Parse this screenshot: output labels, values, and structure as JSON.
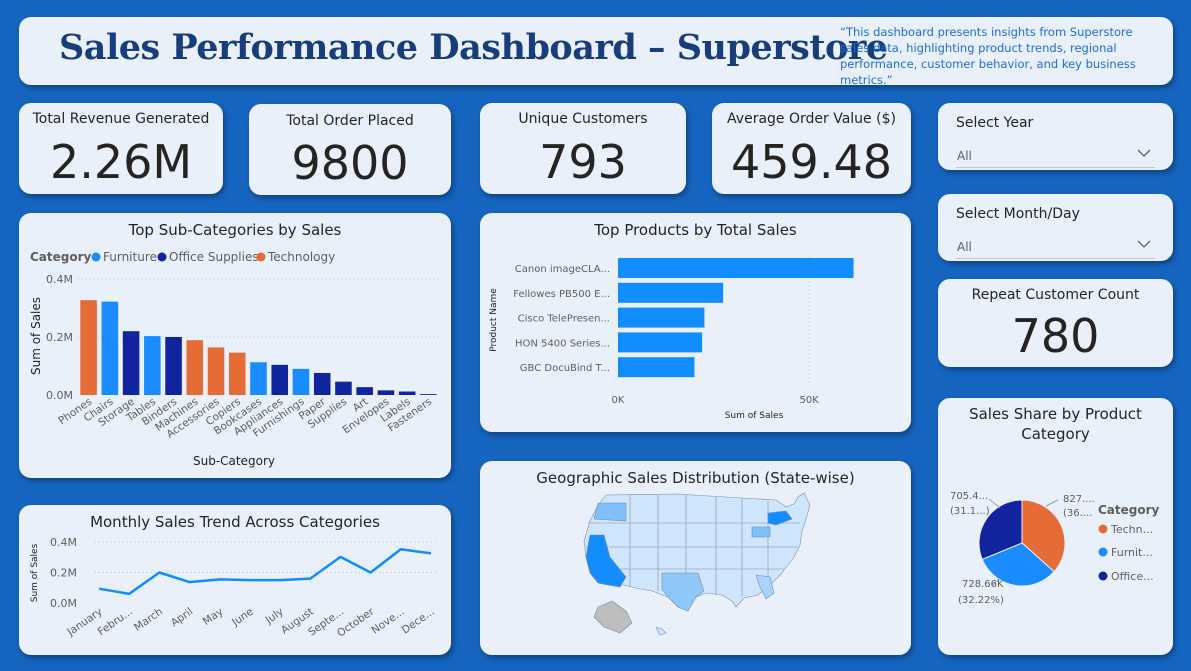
{
  "header": {
    "title": "Sales Performance Dashboard – Superstore",
    "description": "“This dashboard presents insights from Superstore sales data, highlighting product trends, regional performance, customer behavior, and key business metrics.”"
  },
  "kpis": {
    "revenue": {
      "label": "Total Revenue Generated",
      "value": "2.26M"
    },
    "orders": {
      "label": "Total Order Placed",
      "value": "9800"
    },
    "customers": {
      "label": "Unique Customers",
      "value": "793"
    },
    "aov": {
      "label": "Average Order Value ($)",
      "value": "459.48"
    },
    "repeat": {
      "label": "Repeat Customer Count",
      "value": "780"
    }
  },
  "slicers": {
    "year": {
      "label": "Select Year",
      "value": "All"
    },
    "month": {
      "label": "Select Month/Day",
      "value": "All"
    }
  },
  "colors": {
    "Furniture": "#1a8cff",
    "Office Supplies": "#12239e",
    "Technology": "#e66c37",
    "map_fill": "#cfe5fb",
    "map_high": "#118dff"
  },
  "map": {
    "title": "Geographic Sales Distribution (State-wise)"
  },
  "chart_data": [
    {
      "id": "subcat",
      "type": "bar",
      "title": "Top Sub-Categories by Sales",
      "xlabel": "Sub-Category",
      "ylabel": "Sum of Sales",
      "legend_title": "Category",
      "legend": [
        "Furniture",
        "Office Supplies",
        "Technology"
      ],
      "yticks": [
        "0.0M",
        "0.2M",
        "0.4M"
      ],
      "ylim": [
        0,
        400000
      ],
      "grid": true,
      "categories": [
        "Phones",
        "Chairs",
        "Storage",
        "Tables",
        "Binders",
        "Machines",
        "Accessories",
        "Copiers",
        "Bookcases",
        "Appliances",
        "Furnishings",
        "Paper",
        "Supplies",
        "Art",
        "Envelopes",
        "Labels",
        "Fasteners"
      ],
      "values": [
        327000,
        322000,
        220000,
        203000,
        200000,
        189000,
        164000,
        146000,
        113000,
        104000,
        90000,
        76000,
        46000,
        27000,
        16000,
        12000,
        3000
      ],
      "category_group": [
        "Technology",
        "Furniture",
        "Office Supplies",
        "Furniture",
        "Office Supplies",
        "Technology",
        "Technology",
        "Technology",
        "Furniture",
        "Office Supplies",
        "Furniture",
        "Office Supplies",
        "Office Supplies",
        "Office Supplies",
        "Office Supplies",
        "Office Supplies",
        "Office Supplies"
      ]
    },
    {
      "id": "products",
      "type": "bar",
      "orientation": "horizontal",
      "title": "Top Products by Total Sales",
      "xlabel": "Sum of Sales",
      "ylabel": "Product Name",
      "xticks": [
        "0K",
        "50K"
      ],
      "xlim": [
        0,
        68000
      ],
      "categories": [
        "Canon imageCLA...",
        "Fellowes PB500 E...",
        "Cisco TelePresen...",
        "HON 5400 Series...",
        "GBC DocuBind T..."
      ],
      "values": [
        61600,
        27500,
        22600,
        22000,
        20000
      ]
    },
    {
      "id": "monthly",
      "type": "line",
      "title": "Monthly Sales Trend Across Categories",
      "ylabel": "Sum of Sales",
      "yticks": [
        "0.0M",
        "0.2M",
        "0.4M"
      ],
      "ylim": [
        0,
        400000
      ],
      "x": [
        "January",
        "Febru...",
        "March",
        "April",
        "May",
        "June",
        "July",
        "August",
        "Septe...",
        "October",
        "Nove...",
        "Dece..."
      ],
      "values": [
        94000,
        60000,
        200000,
        137000,
        155000,
        150000,
        150000,
        160000,
        302000,
        200000,
        352000,
        325000
      ]
    },
    {
      "id": "pie",
      "type": "pie",
      "title": "Sales Share by Product Category",
      "legend_title": "Category",
      "slices": [
        {
          "name": "Technology",
          "legend_label": "Techn...",
          "value": 827000,
          "share": 0.366,
          "value_label": "827....",
          "pct_label": "(36...."
        },
        {
          "name": "Furniture",
          "legend_label": "Furnit...",
          "value": 728660,
          "share": 0.3222,
          "value_label": "728.66K",
          "pct_label": "(32.22%)"
        },
        {
          "name": "Office Supplies",
          "legend_label": "Office...",
          "value": 705400,
          "share": 0.3118,
          "value_label": "705.4...",
          "pct_label": "(31.1...)"
        }
      ]
    }
  ]
}
